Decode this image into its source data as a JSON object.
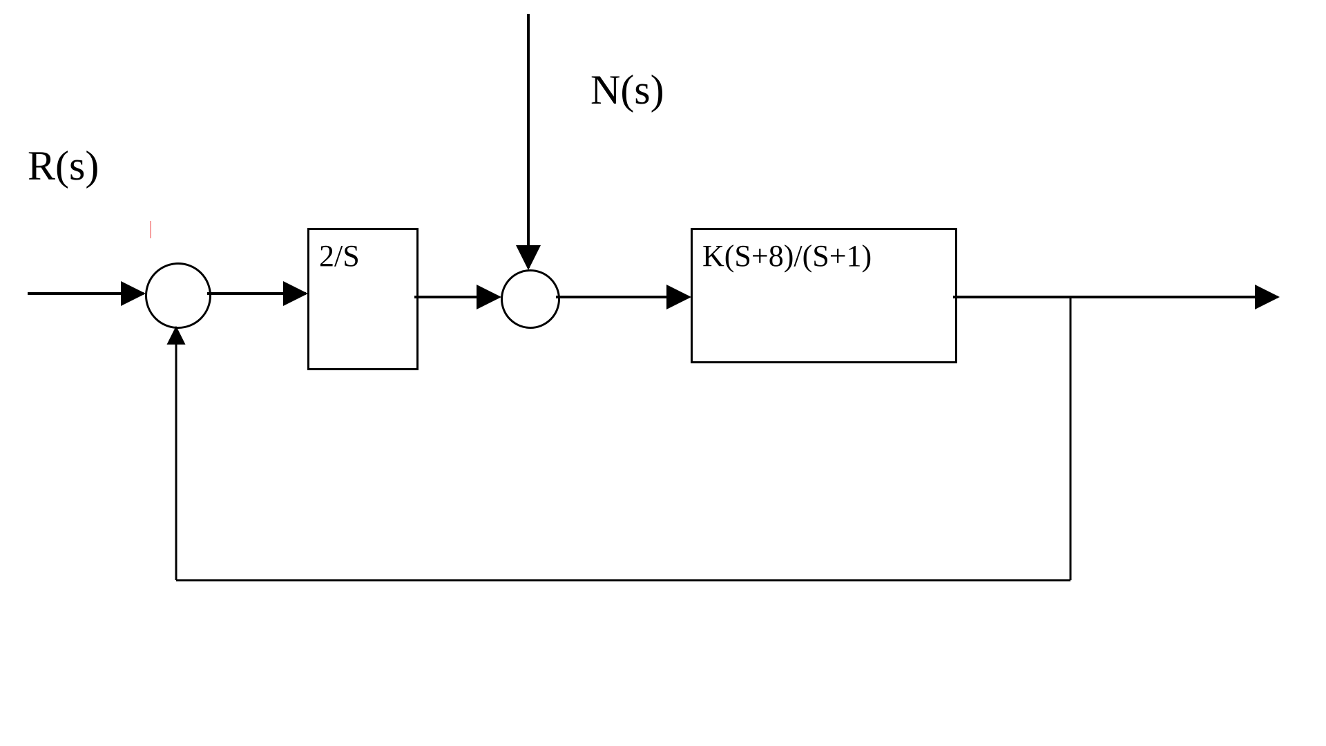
{
  "labels": {
    "input": "R(s)",
    "disturbance": "N(s)"
  },
  "blocks": {
    "g1": "2/S",
    "g2": "K(S+8)/(S+1)"
  },
  "diagram": {
    "type": "control-block-diagram",
    "signals": [
      "R(s)",
      "N(s)"
    ],
    "summing_junctions": 2,
    "forward_path": [
      "2/S",
      "K(S+8)/(S+1)"
    ],
    "feedback": "unity",
    "disturbance_entry": "between G1 and G2"
  }
}
